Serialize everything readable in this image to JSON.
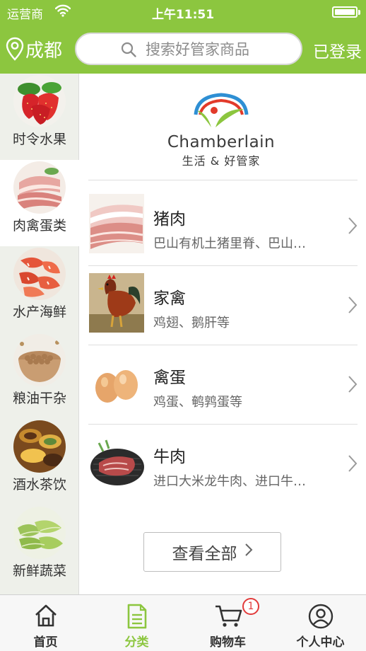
{
  "status_bar": {
    "carrier": "运营商",
    "time": "上午11:51"
  },
  "header": {
    "city": "成都",
    "search_placeholder": "搜索好管家商品",
    "login_label": "已登录",
    "accent_color": "#8cc63f"
  },
  "sidebar": {
    "items": [
      {
        "label": "时令水果",
        "icon": "strawberry-thumb"
      },
      {
        "label": "肉禽蛋类",
        "icon": "meat-thumb",
        "active": true
      },
      {
        "label": "水产海鲜",
        "icon": "shrimp-thumb"
      },
      {
        "label": "粮油干杂",
        "icon": "beans-thumb"
      },
      {
        "label": "酒水茶饮",
        "icon": "tea-thumb"
      },
      {
        "label": "新鲜蔬菜",
        "icon": "vegetable-thumb"
      }
    ]
  },
  "brand": {
    "name": "Chamberlain",
    "tagline": "生活 & 好管家"
  },
  "categories": [
    {
      "title": "猪肉",
      "desc": "巴山有机土猪里脊、巴山…",
      "icon": "pork-image"
    },
    {
      "title": "家禽",
      "desc": "鸡翅、鹅肝等",
      "icon": "rooster-image"
    },
    {
      "title": "禽蛋",
      "desc": "鸡蛋、鹌鹑蛋等",
      "icon": "eggs-image"
    },
    {
      "title": "牛肉",
      "desc": "进口大米龙牛肉、进口牛…",
      "icon": "beef-image"
    }
  ],
  "view_all_label": "查看全部",
  "tabbar": {
    "tabs": [
      {
        "label": "首页",
        "icon": "home-icon"
      },
      {
        "label": "分类",
        "icon": "category-icon",
        "active": true
      },
      {
        "label": "购物车",
        "icon": "cart-icon",
        "badge": "1"
      },
      {
        "label": "个人中心",
        "icon": "user-icon"
      }
    ]
  }
}
